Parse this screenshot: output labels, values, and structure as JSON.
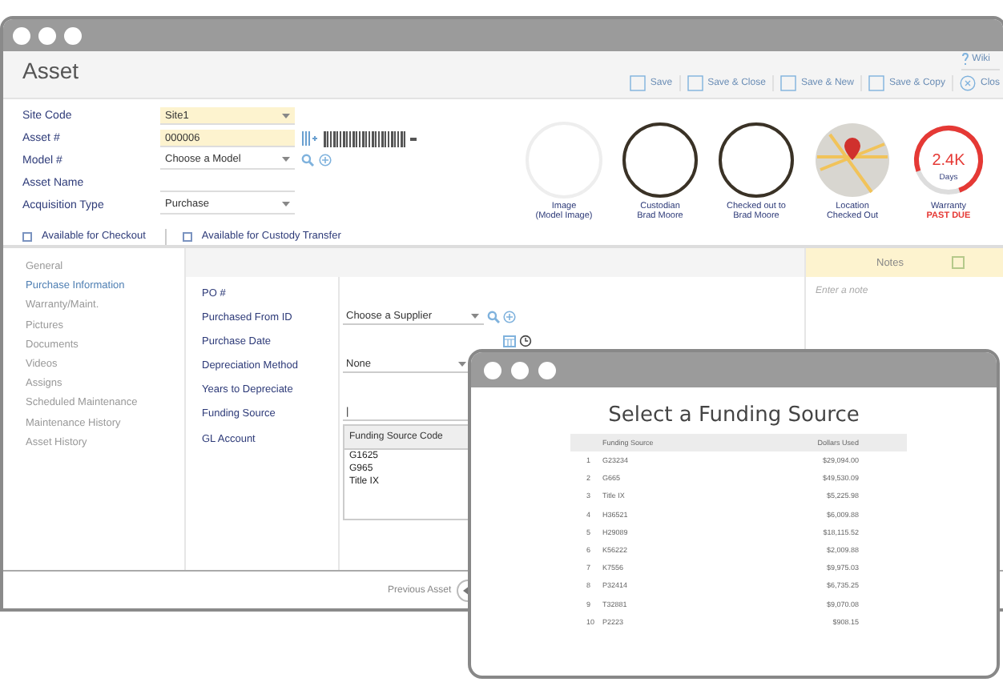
{
  "window": {
    "title": "Asset",
    "help_link": "Wiki"
  },
  "toolbar": [
    "Save",
    "Save & Close",
    "Save & New",
    "Save & Copy",
    "Clos"
  ],
  "form_fields": [
    {
      "label": "Site Code",
      "value": "Site1",
      "kind": "select",
      "highlighted": true
    },
    {
      "label": "Asset #",
      "value": "000006",
      "kind": "barcode",
      "highlighted": true
    },
    {
      "label": "Model #",
      "value": "Choose a Model",
      "kind": "lookup",
      "highlighted": false
    },
    {
      "label": "Asset Name",
      "kind": "text",
      "highlighted": false
    },
    {
      "label": "Acquisition Type",
      "value": "Purchase",
      "kind": "select",
      "highlighted": false
    }
  ],
  "checkboxes": [
    {
      "label": "Available for Checkout",
      "checked": false
    },
    {
      "label": "Available for Custody Transfer",
      "checked": false
    }
  ],
  "widgets": [
    {
      "kind": "image",
      "label": "Image",
      "value": "(Model Image)"
    },
    {
      "kind": "avatar",
      "label": "Custodian",
      "value": "Brad Moore"
    },
    {
      "kind": "avatar",
      "label": "Checked out to",
      "value": "Brad Moore"
    },
    {
      "kind": "map",
      "label": "Location",
      "value": "Checked Out"
    },
    {
      "kind": "gauge",
      "label": "Warranty",
      "value": "PAST DUE",
      "reading": "2.4K",
      "unit": "Days",
      "level": 0.75
    }
  ],
  "sidebar": {
    "items": [
      {
        "label": "General",
        "selected": false
      },
      {
        "label": "Purchase Information",
        "selected": true
      },
      {
        "label": "Warranty/Maint.",
        "selected": false
      },
      {
        "label": "Pictures",
        "selected": false
      },
      {
        "label": "Documents",
        "selected": false
      },
      {
        "label": "Videos",
        "selected": false
      },
      {
        "label": "Assigns",
        "selected": false
      },
      {
        "label": "Scheduled Maintenance",
        "selected": false
      },
      {
        "label": "Maintenance History",
        "selected": false
      },
      {
        "label": "Asset History",
        "selected": false
      }
    ]
  },
  "purchase_fields": [
    {
      "label": "PO #",
      "kind": "text"
    },
    {
      "label": "Purchased From ID",
      "kind": "lookup",
      "value": "Choose a Supplier"
    },
    {
      "label": "Purchase Date",
      "kind": "date"
    },
    {
      "label": "Depreciation Method",
      "kind": "select",
      "value": "None"
    },
    {
      "label": "Years to Depreciate",
      "kind": "text"
    },
    {
      "label": "Funding Source",
      "kind": "combo",
      "value": "|"
    },
    {
      "label": "GL Account",
      "kind": "none"
    }
  ],
  "funding_dropdown": {
    "header": "Funding Source Code",
    "options": [
      "G1625",
      "G965",
      "Title IX"
    ]
  },
  "notes": {
    "title": "Notes",
    "placeholder": "Enter a note"
  },
  "footer": {
    "previous": "Previous Asset"
  },
  "popup": {
    "title": "Select a Funding Source",
    "columns": [
      "",
      "Funding Source",
      "Dollars Used"
    ],
    "rows": [
      [
        "1",
        "G23234",
        "$29,094.00"
      ],
      [
        "2",
        "G665",
        "$49,530.09"
      ],
      [
        "3",
        "Title IX",
        "$5,225.98"
      ],
      [
        "4",
        "H36521",
        "$6,009.88"
      ],
      [
        "5",
        "H29089",
        "$18,115.52"
      ],
      [
        "6",
        "K56222",
        "$2,009.88"
      ],
      [
        "7",
        "K7556",
        "$9,975.03"
      ],
      [
        "8",
        "P32414",
        "$6,735.25"
      ],
      [
        "9",
        "T32881",
        "$9,070.08"
      ],
      [
        "10",
        "P2223",
        "$908.15"
      ]
    ]
  }
}
